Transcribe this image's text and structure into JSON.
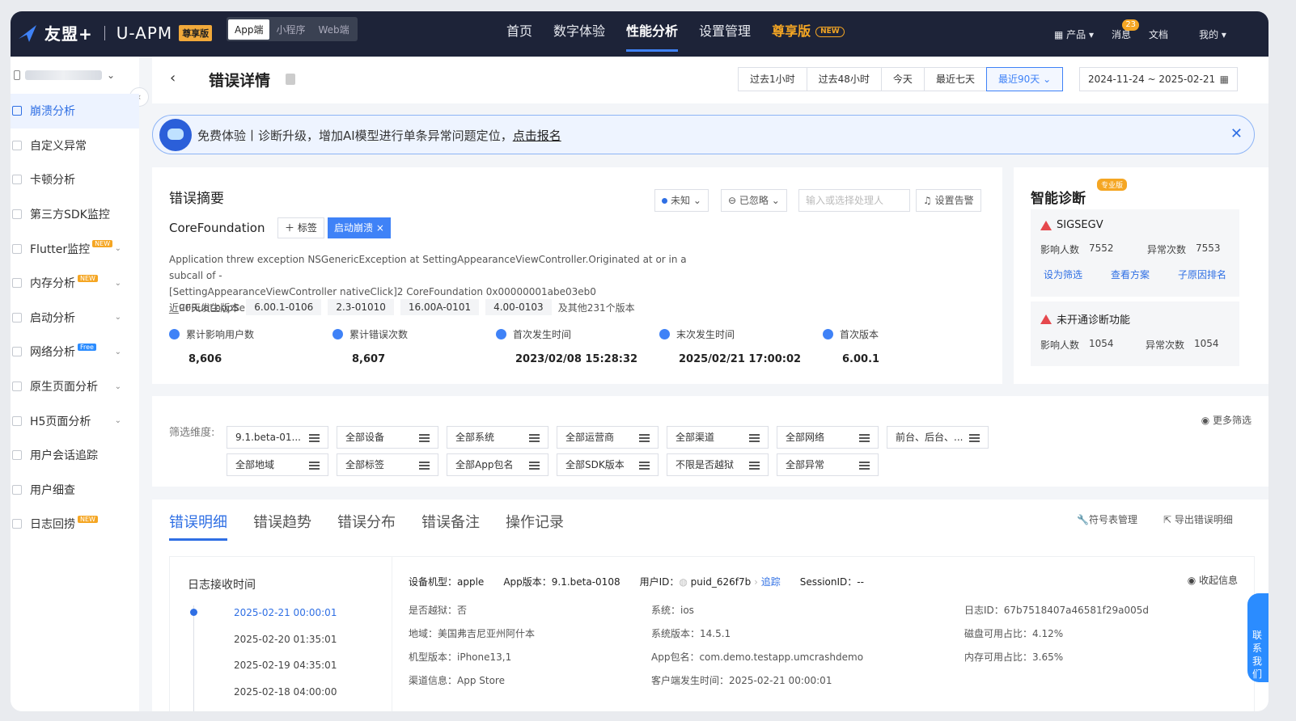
{
  "topbar": {
    "brand": "友盟+",
    "product": "U-APM",
    "vip_tag": "尊享版",
    "platforms": [
      "App端",
      "小程序",
      "Web端"
    ],
    "active_platform": 0,
    "nav": [
      "首页",
      "数字体验",
      "性能分析",
      "设置管理"
    ],
    "active_nav": 2,
    "premium": "尊享版",
    "premium_badge": "NEW",
    "right": {
      "products": "产品",
      "messages": "消息",
      "messages_badge": "23",
      "docs": "文档",
      "mine": "我的"
    }
  },
  "sidebar": {
    "items": [
      {
        "label": "崩溃分析"
      },
      {
        "label": "自定义异常"
      },
      {
        "label": "卡顿分析"
      },
      {
        "label": "第三方SDK监控"
      },
      {
        "label": "Flutter监控",
        "tag": "NEW"
      },
      {
        "label": "内存分析",
        "tag": "NEW"
      },
      {
        "label": "启动分析"
      },
      {
        "label": "网络分析",
        "tag": "Free"
      },
      {
        "label": "原生页面分析"
      },
      {
        "label": "H5页面分析"
      },
      {
        "label": "用户会话追踪"
      },
      {
        "label": "用户细查"
      },
      {
        "label": "日志回捞",
        "tag": "NEW"
      }
    ]
  },
  "header": {
    "title": "错误详情",
    "ranges": [
      "过去1小时",
      "过去48小时",
      "今天",
      "最近七天",
      "最近90天"
    ],
    "selected_range": "最近90天",
    "date_range": "2024-11-24 ~ 2025-02-21"
  },
  "banner": {
    "text": "免费体验丨诊断升级，增加AI模型进行单条异常问题定位，",
    "link": "点击报名"
  },
  "summary": {
    "title": "错误摘要",
    "status": "未知",
    "ignored": "已忽略",
    "handler_placeholder": "输入或选择处理人",
    "alert": "设置告警",
    "module": "CoreFoundation",
    "tag_btn": "标签",
    "tag_chip": "启动崩溃",
    "exception_line1": "Application threw exception NSGenericException at SettingAppearanceViewController.Originated at or in a subcall of -",
    "exception_line2": "[SettingAppearanceViewController nativeClick]2 CoreFoundation 0x00000001abe03eb0 __CFRunLoopServiceMachPort",
    "versions_label": "近90天发生版本",
    "versions": [
      "6.00.1-0106",
      "2.3-01010",
      "16.00A-0101",
      "4.00-0103"
    ],
    "versions_more": "及其他231个版本",
    "stats": [
      {
        "label": "累计影响用户数",
        "value": "8,606"
      },
      {
        "label": "累计错误次数",
        "value": "8,607"
      },
      {
        "label": "首次发生时间",
        "value": "2023/02/08 15:28:32"
      },
      {
        "label": "末次发生时间",
        "value": "2025/02/21 17:00:02"
      },
      {
        "label": "首次版本",
        "value": "6.00.1"
      }
    ]
  },
  "diagnosis": {
    "title": "智能诊断",
    "pro_tag": "专业版",
    "items": [
      {
        "title": "SIGSEGV",
        "users_label": "影响人数",
        "users": "7552",
        "count_label": "异常次数",
        "count": "7553",
        "links": [
          "设为筛选",
          "查看方案",
          "子原因排名"
        ]
      },
      {
        "title": "未开通诊断功能",
        "users_label": "影响人数",
        "users": "1054",
        "count_label": "异常次数",
        "count": "1054"
      }
    ]
  },
  "filters": {
    "label": "筛选维度:",
    "row1": [
      "9.1.beta-01...",
      "全部设备",
      "全部系统",
      "全部运营商",
      "全部渠道",
      "全部网络",
      "前台、后台、..."
    ],
    "row2": [
      "全部地域",
      "全部标签",
      "全部App包名",
      "全部SDK版本",
      "不限是否越狱",
      "全部异常"
    ],
    "more": "更多筛选"
  },
  "details": {
    "tabs": [
      "错误明细",
      "错误趋势",
      "错误分布",
      "错误备注",
      "操作记录"
    ],
    "active_tab": 0,
    "symbol_mgmt": "符号表管理",
    "export": "导出错误明细",
    "log_title": "日志接收时间",
    "log_times": [
      "2025-02-21 00:00:01",
      "2025-02-20 01:35:01",
      "2025-02-19 04:35:01",
      "2025-02-18 04:00:00"
    ],
    "head": {
      "device": "设备机型：apple",
      "app_version": "App版本：9.1.beta-0108",
      "user_label": "用户ID：",
      "user_id": "puid_626f7b",
      "trace": "追踪",
      "session": "SessionID：--",
      "collapse": "收起信息"
    },
    "col1": [
      "是否越狱：否",
      "地域：美国弗吉尼亚州阿什本",
      "机型版本：iPhone13,1",
      "渠道信息：App Store"
    ],
    "col2": [
      "系统：ios",
      "系统版本：14.5.1",
      "App包名：com.demo.testapp.umcrashdemo",
      "客户端发生时间：2025-02-21 00:00:01"
    ],
    "col3": [
      "日志ID：67b7518407a46581f29a005d",
      "磁盘可用占比：4.12%",
      "内存可用占比：3.65%"
    ]
  },
  "float_help": "联系我们"
}
